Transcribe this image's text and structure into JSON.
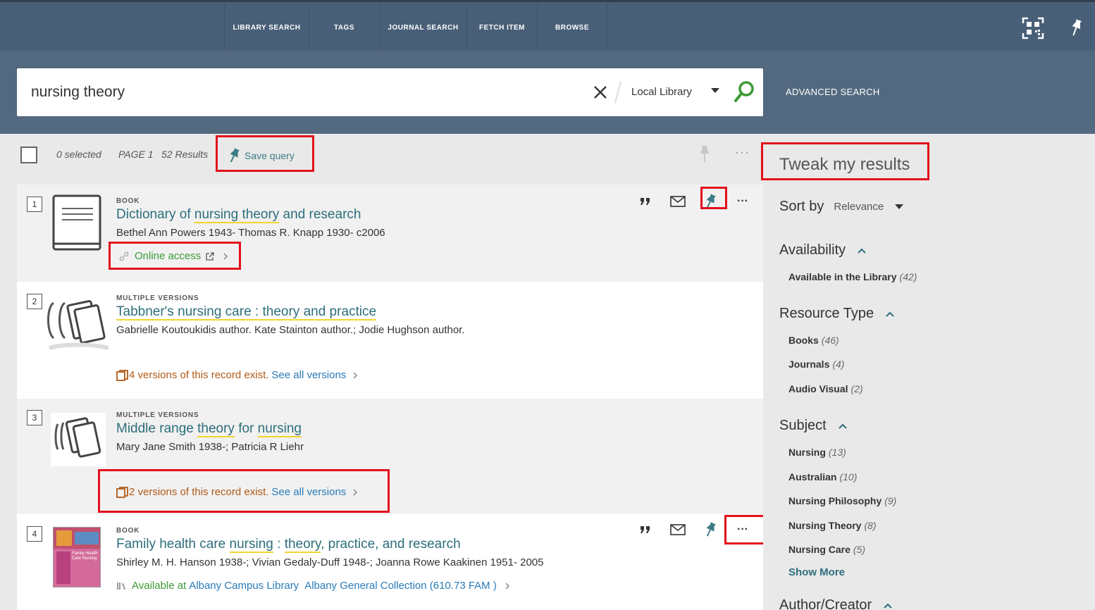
{
  "nav": {
    "items": [
      {
        "label": "LIBRARY SEARCH"
      },
      {
        "label": "TAGS"
      },
      {
        "label": "JOURNAL SEARCH"
      },
      {
        "label": "FETCH ITEM"
      },
      {
        "label": "BROWSE"
      }
    ]
  },
  "search": {
    "query": "nursing theory",
    "scope": "Local Library",
    "advanced_label": "ADVANCED SEARCH"
  },
  "toolbar": {
    "selected": "0 selected",
    "page": "PAGE 1",
    "results": "52 Results",
    "save_query": "Save query"
  },
  "results": [
    {
      "num": "1",
      "type": "BOOK",
      "title_parts": [
        "Dictionary of ",
        "nursing theory",
        " and research"
      ],
      "authors": "Bethel Ann Powers 1943- Thomas R. Knapp 1930- c2006",
      "online_access": "Online access"
    },
    {
      "num": "2",
      "type": "MULTIPLE VERSIONS",
      "title_parts": [
        "Tabbner's ",
        "nursing",
        " care : ",
        "theory",
        " and practice"
      ],
      "authors": "Gabrielle Koutoukidis author. Kate Stainton author.; Jodie Hughson author.",
      "versions_text": "4 versions of this record exist.",
      "see_all": "See all versions"
    },
    {
      "num": "3",
      "type": "MULTIPLE VERSIONS",
      "title_parts": [
        "Middle range ",
        "theory",
        " for ",
        "nursing"
      ],
      "authors": "Mary Jane Smith 1938-; Patricia R Liehr",
      "versions_text": "2 versions of this record exist.",
      "see_all": "See all versions"
    },
    {
      "num": "4",
      "type": "BOOK",
      "title_parts": [
        "Family health care ",
        "nursing",
        " : ",
        "theory",
        ", practice, and research"
      ],
      "authors": "Shirley M. H. Hanson 1938-; Vivian Gedaly-Duff 1948-; Joanna Rowe Kaakinen 1951- 2005",
      "available_at": "Available at",
      "location": "Albany Campus Library",
      "collection": "Albany General Collection (610.73 FAM )",
      "cover_text": "Family Health Care Nursing"
    }
  ],
  "facets": {
    "title": "Tweak my results",
    "sort_label": "Sort by",
    "sort_value": "Relevance",
    "availability": {
      "label": "Availability",
      "items": [
        {
          "name": "Available in the Library",
          "count": "(42)"
        }
      ]
    },
    "resource_type": {
      "label": "Resource Type",
      "items": [
        {
          "name": "Books",
          "count": "(46)"
        },
        {
          "name": "Journals",
          "count": "(4)"
        },
        {
          "name": "Audio Visual",
          "count": "(2)"
        }
      ]
    },
    "subject": {
      "label": "Subject",
      "items": [
        {
          "name": "Nursing",
          "count": "(13)"
        },
        {
          "name": "Australian",
          "count": "(10)"
        },
        {
          "name": "Nursing Philosophy",
          "count": "(9)"
        },
        {
          "name": "Nursing Theory",
          "count": "(8)"
        },
        {
          "name": "Nursing Care",
          "count": "(5)"
        }
      ]
    },
    "show_more": "Show More",
    "author_creator": {
      "label": "Author/Creator"
    }
  },
  "colors": {
    "header": "#485f77",
    "searchband": "#53697f",
    "link": "#2c6e7b",
    "highlight_box": "#e3101b",
    "online": "#3c9a35",
    "versions": "#b15a18"
  }
}
